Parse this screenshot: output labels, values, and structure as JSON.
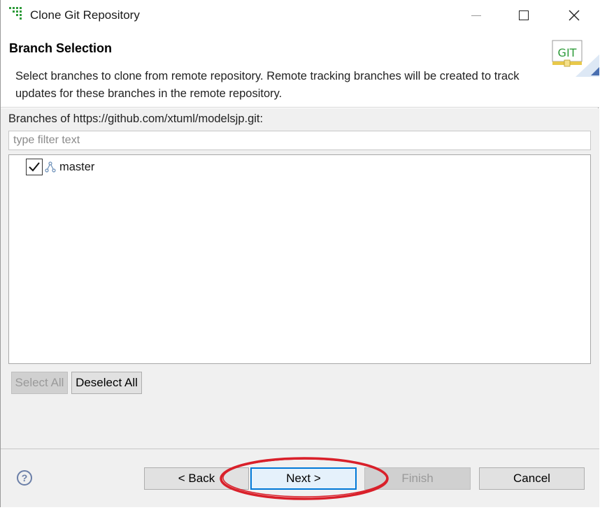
{
  "window": {
    "title": "Clone Git Repository",
    "icons": {
      "app": "egit-grid-icon",
      "minimize": "minimize-icon",
      "maximize": "maximize-icon",
      "close": "close-icon"
    }
  },
  "header": {
    "title": "Branch Selection",
    "description": "Select branches to clone from remote repository. Remote tracking branches will be created to track updates for these branches in the remote repository.",
    "banner_text": "GIT"
  },
  "branches": {
    "label": "Branches of https://github.com/xtuml/modelsjp.git:",
    "filter_placeholder": "type filter text",
    "filter_value": "",
    "items": [
      {
        "label": "master",
        "checked": true,
        "icon": "branch-icon"
      }
    ]
  },
  "selection_buttons": {
    "select_all": "Select All",
    "select_all_enabled": false,
    "deselect_all": "Deselect All"
  },
  "footer": {
    "help": "?",
    "back": "< Back",
    "next": "Next >",
    "finish": "Finish",
    "finish_enabled": false,
    "cancel": "Cancel"
  },
  "colors": {
    "accent": "#0078d7",
    "annotation": "#d9202a",
    "dialog_bg": "#f0f0f0"
  }
}
